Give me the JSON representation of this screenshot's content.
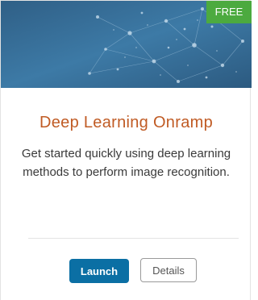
{
  "card": {
    "badge": "FREE",
    "title": "Deep Learning Onramp",
    "description": "Get started quickly using deep learning methods to perform image recognition.",
    "launch_label": "Launch",
    "details_label": "Details"
  },
  "colors": {
    "hero_background": "#3a6e96",
    "badge_background": "#4caa3f",
    "title": "#c05b24",
    "launch_button": "#0b6fa4"
  }
}
